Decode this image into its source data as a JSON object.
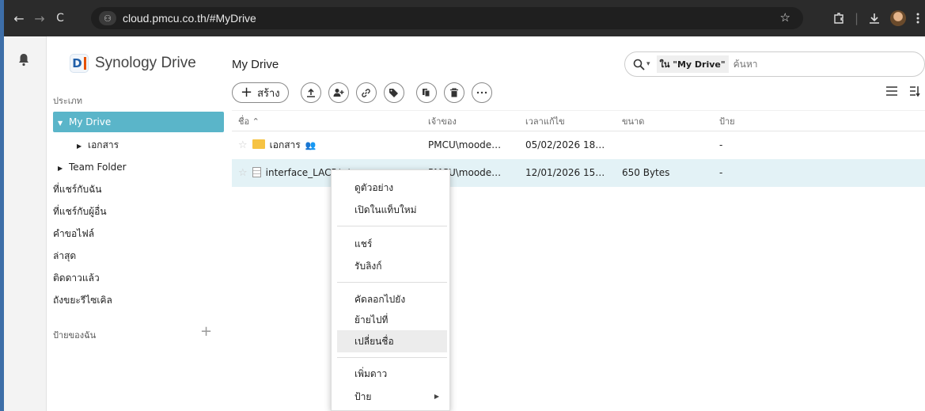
{
  "browser": {
    "url": "cloud.pmcu.co.th/#MyDrive",
    "site_icon": "⚇",
    "back": "←",
    "forward": "→",
    "reload": "C",
    "star": "☆"
  },
  "app": {
    "logo_text": "Synology Drive",
    "logo_letter": "D"
  },
  "sidebar": {
    "section_label": "ประเภท",
    "items": [
      {
        "label": "My Drive",
        "caret": "▼"
      },
      {
        "label": "เอกสาร",
        "caret": "▶"
      },
      {
        "label": "Team Folder",
        "caret": "▶"
      },
      {
        "label": "ที่แชร์กับฉัน"
      },
      {
        "label": "ที่แชร์กับผู้อื่น"
      },
      {
        "label": "คำขอไฟล์"
      },
      {
        "label": "ล่าสุด"
      },
      {
        "label": "ติดดาวแล้ว"
      },
      {
        "label": "ถังขยะรีไซเคิล"
      }
    ],
    "tags_label": "ป้ายของฉัน",
    "tags_add": "+"
  },
  "main": {
    "title": "My Drive",
    "search": {
      "scope": "ใน \"My Drive\"",
      "placeholder": "ค้นหา"
    },
    "toolbar": {
      "create_label": "สร้าง",
      "create_plus": "+"
    },
    "columns": {
      "name": "ชื่อ ⌃",
      "owner": "เจ้าของ",
      "modified": "เวลาแก้ไข",
      "size": "ขนาด",
      "tag": "ป้าย"
    },
    "rows": [
      {
        "name": "เอกสาร",
        "owner": "PMCU\\moode…",
        "modified": "05/02/2026 18…",
        "size": "",
        "tag": "-"
      },
      {
        "name": "interface_LACP.txt",
        "owner": "PMCU\\moode…",
        "modified": "12/01/2026 15…",
        "size": "650 Bytes",
        "tag": "-"
      }
    ]
  },
  "context_menu": {
    "items": [
      {
        "label": "ดูตัวอย่าง"
      },
      {
        "label": "เปิดในแท็บใหม่"
      },
      {
        "label": "แชร์"
      },
      {
        "label": "รับลิงก์"
      },
      {
        "label": "คัดลอกไปยัง"
      },
      {
        "label": "ย้ายไปที่"
      },
      {
        "label": "เปลี่ยนชื่อ"
      },
      {
        "label": "เพิ่มดาว"
      },
      {
        "label": "ป้าย"
      }
    ]
  },
  "colors": {
    "accent": "#5ab5c9",
    "chrome_bg": "#2b2b2b",
    "selected_row": "#e3f2f6",
    "folder": "#f6c343"
  }
}
